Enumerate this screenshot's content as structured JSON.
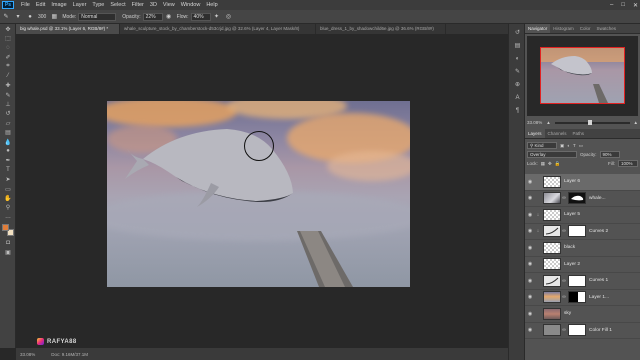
{
  "app": {
    "logo": "Ps"
  },
  "menu": [
    "File",
    "Edit",
    "Image",
    "Layer",
    "Type",
    "Select",
    "Filter",
    "3D",
    "View",
    "Window",
    "Help"
  ],
  "window_controls": [
    "minimize-icon",
    "maximize-icon",
    "close-icon"
  ],
  "options": {
    "brush_size": "300",
    "mode_label": "Mode:",
    "mode_value": "Normal",
    "opacity_label": "Opacity:",
    "opacity_value": "22%",
    "flow_label": "Flow:",
    "flow_value": "40%"
  },
  "tabs": [
    {
      "label": "big whale.psd @ 33.1% (Layer 6, RGB/8#) *",
      "active": true
    },
    {
      "label": "whale_sculpture_stock_by_chamberstock-d53crjd.jpg @ 32.6% (Layer 4, Layer Mask/8)",
      "active": false
    },
    {
      "label": "blue_dress_1_by_shadowchild6e.jpg @ 36.6% (RGB/8#)",
      "active": false
    }
  ],
  "colors": {
    "foreground": "#e07d3a",
    "background": "#f2e1c2",
    "selection_box": "#e22222"
  },
  "status": {
    "zoom": "33.08%",
    "doc": "Doc: 9.16M/37.1M"
  },
  "watermark": {
    "text": "RAFYA88"
  },
  "navigator": {
    "tabs": [
      "Navigator",
      "Histogram",
      "Color",
      "Swatches"
    ],
    "zoom": "33.08%",
    "zoom_level_fraction": 0.44
  },
  "layers_panel": {
    "tabs": [
      "Layers",
      "Channels",
      "Paths"
    ],
    "kind_label": "Kind",
    "blend_mode": "Overlay",
    "opacity_label": "Opacity:",
    "opacity_value": "90%",
    "lock_label": "Lock:",
    "fill_label": "Fill:",
    "fill_value": "100%",
    "layers": [
      {
        "name": "Layer 6",
        "thumb": "checker",
        "mask": false,
        "selected": true,
        "clipped": false
      },
      {
        "name": "whale...",
        "thumb": "whale",
        "mask": "whale-mask",
        "selected": false,
        "clipped": false
      },
      {
        "name": "Layer 5",
        "thumb": "checker",
        "mask": false,
        "selected": false,
        "clipped": true
      },
      {
        "name": "Curves 2",
        "thumb": "curves",
        "mask": "white",
        "selected": false,
        "clipped": true
      },
      {
        "name": "black",
        "thumb": "checker",
        "mask": false,
        "selected": false,
        "clipped": false
      },
      {
        "name": "Layer 2",
        "thumb": "checker",
        "mask": false,
        "selected": false,
        "clipped": false
      },
      {
        "name": "Curves 1",
        "thumb": "curves",
        "mask": "white",
        "selected": false,
        "clipped": false
      },
      {
        "name": "Layer 1...",
        "thumb": "sky",
        "mask": "black-white",
        "selected": false,
        "clipped": false
      },
      {
        "name": "sky",
        "thumb": "sky2",
        "mask": false,
        "selected": false,
        "clipped": false
      },
      {
        "name": "Color Fill 1",
        "thumb": "gray",
        "mask": "white",
        "selected": false,
        "clipped": false
      }
    ]
  }
}
